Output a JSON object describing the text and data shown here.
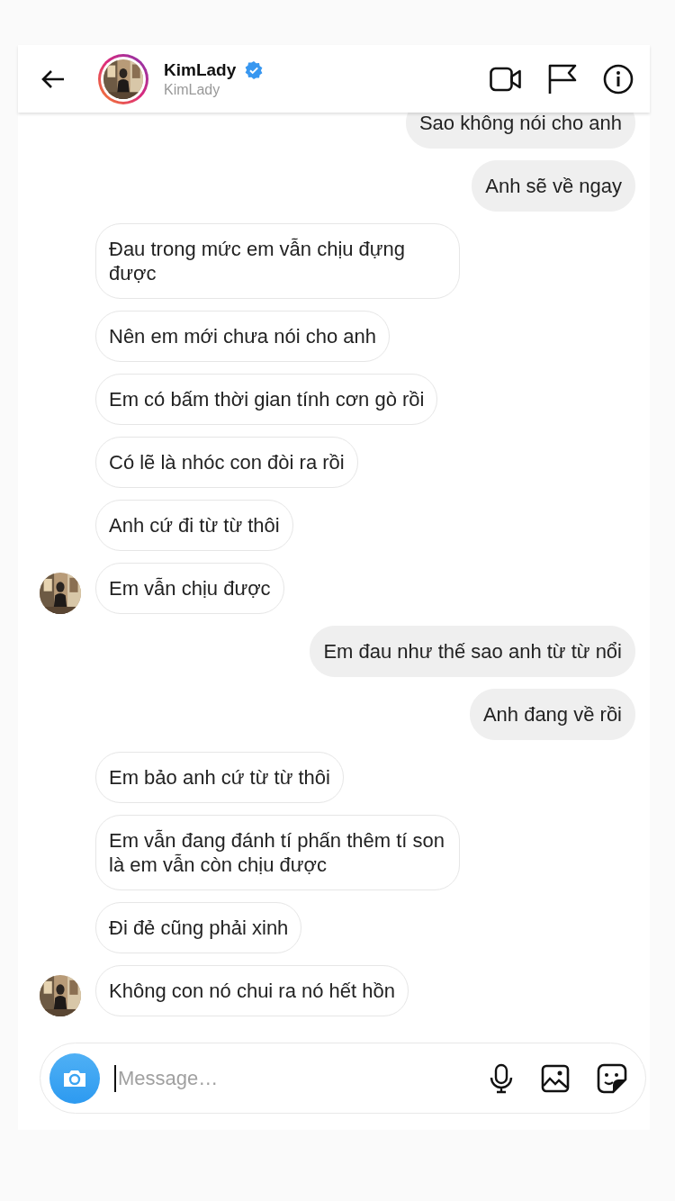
{
  "header": {
    "name": "KimLady",
    "verified": true,
    "username": "KimLady"
  },
  "messages": [
    {
      "text": "Sao không nói cho anh",
      "kind": "sent"
    },
    {
      "text": "Anh sẽ về ngay",
      "kind": "sent"
    },
    {
      "text": "Đau trong mức em vẫn chịu đựng được",
      "kind": "received",
      "show_avatar": false
    },
    {
      "text": "Nên em mới chưa nói cho anh",
      "kind": "received",
      "show_avatar": false
    },
    {
      "text": "Em có bấm thời gian tính cơn gò rồi",
      "kind": "received",
      "show_avatar": false
    },
    {
      "text": "Có lẽ là nhóc con đòi ra rồi",
      "kind": "received",
      "show_avatar": false
    },
    {
      "text": "Anh cứ đi từ từ thôi",
      "kind": "received",
      "show_avatar": false
    },
    {
      "text": "Em vẫn chịu được",
      "kind": "received",
      "show_avatar": true
    },
    {
      "text": "Em đau như thế sao anh từ từ nổi",
      "kind": "sent"
    },
    {
      "text": "Anh đang về rồi",
      "kind": "sent"
    },
    {
      "text": "Em bảo anh cứ từ từ thôi",
      "kind": "received",
      "show_avatar": false
    },
    {
      "text": "Em vẫn đang đánh tí phấn thêm tí son là em vẫn còn chịu được",
      "kind": "received",
      "show_avatar": false
    },
    {
      "text": "Đi đẻ cũng phải xinh",
      "kind": "received",
      "show_avatar": false
    },
    {
      "text": "Không con nó chui ra nó hết hồn",
      "kind": "received",
      "show_avatar": true
    }
  ],
  "composer": {
    "placeholder": "Message…"
  }
}
